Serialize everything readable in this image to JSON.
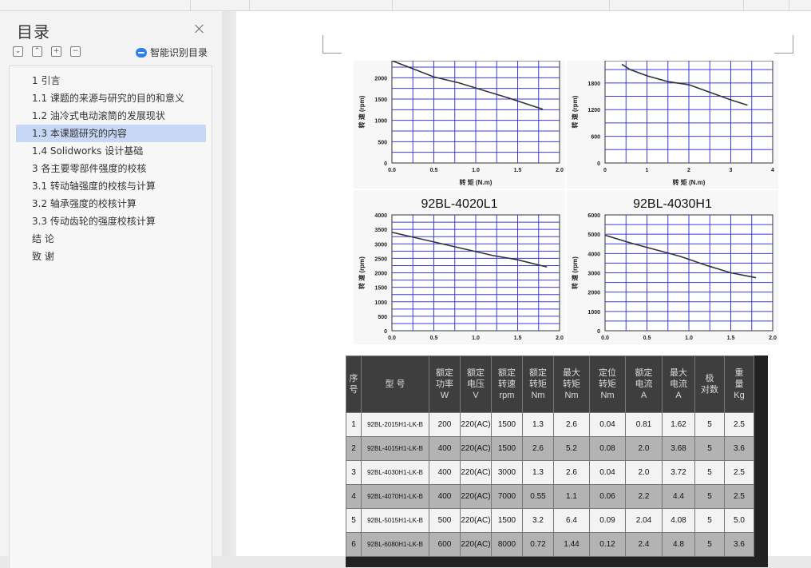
{
  "toc": {
    "title": "目录",
    "smart_label": "智能识别目录",
    "expand_btn": "⌄",
    "collapse_btn": "⌃",
    "add_btn": "+",
    "remove_btn": "−",
    "items": [
      {
        "label": "1 引言",
        "indent": 0,
        "active": false
      },
      {
        "label": "1.1  课题的来源与研究的目的和意义",
        "indent": 0,
        "active": false
      },
      {
        "label": "1.2  油冷式电动滚筒的发展现状",
        "indent": 0,
        "active": false
      },
      {
        "label": "1.3  本课题研究的内容",
        "indent": 0,
        "active": true
      },
      {
        "label": "1.4 Solidworks 设计基础",
        "indent": 0,
        "active": false
      },
      {
        "label": "3 各主要零部件强度的校核",
        "indent": 0,
        "active": false
      },
      {
        "label": "3.1  转动轴强度的校核与计算",
        "indent": 0,
        "active": false
      },
      {
        "label": "3.2  轴承强度的校核计算",
        "indent": 0,
        "active": false
      },
      {
        "label": "3.3  传动齿轮的强度校核计算",
        "indent": 0,
        "active": false
      },
      {
        "label": "结      论",
        "indent": 0,
        "active": false
      },
      {
        "label": "致      谢",
        "indent": 0,
        "active": false
      }
    ]
  },
  "chart_data": [
    {
      "type": "line",
      "title": "",
      "xlabel": "转  矩   (N.m)",
      "ylabel": "转 速  (rpm)",
      "xlim": [
        0,
        2.0
      ],
      "x_ticks": [
        "0.0",
        "0.5",
        "1.0",
        "1.5",
        "2.0"
      ],
      "y_ticks": [
        "0",
        "500",
        "1000",
        "1500",
        "2000"
      ],
      "series": [
        {
          "x": [
            0.0,
            0.2,
            0.5,
            0.8,
            1.1,
            1.4,
            1.8
          ],
          "y": [
            2400,
            2250,
            2020,
            1880,
            1700,
            1520,
            1260
          ]
        }
      ]
    },
    {
      "type": "line",
      "title": "",
      "xlabel": "转  矩   (N.m)",
      "ylabel": "转 速  (rpm)",
      "xlim": [
        0,
        4
      ],
      "x_ticks": [
        "0",
        "1",
        "2",
        "3",
        "4"
      ],
      "y_ticks": [
        "0",
        "600",
        "1200",
        "1800"
      ],
      "series": [
        {
          "x": [
            0.4,
            0.6,
            1.0,
            1.5,
            2.0,
            2.5,
            3.0,
            3.4
          ],
          "y": [
            2220,
            2100,
            1960,
            1830,
            1760,
            1590,
            1420,
            1300
          ]
        }
      ]
    },
    {
      "type": "line",
      "title": "92BL-4020L1",
      "xlabel": "",
      "ylabel": "转 速  (rpm)",
      "xlim": [
        0,
        2.0
      ],
      "ylim": [
        0,
        4000
      ],
      "x_ticks": [
        "0.0",
        "0.5",
        "1.0",
        "1.5",
        "2.0"
      ],
      "y_ticks": [
        "0",
        "500",
        "1000",
        "1500",
        "2000",
        "2500",
        "3000",
        "3500",
        "4000"
      ],
      "series": [
        {
          "x": [
            0.0,
            0.3,
            0.6,
            0.9,
            1.2,
            1.5,
            1.85
          ],
          "y": [
            3400,
            3200,
            3000,
            2800,
            2600,
            2450,
            2200
          ]
        }
      ]
    },
    {
      "type": "line",
      "title": "92BL-4030H1",
      "xlabel": "",
      "ylabel": "转 速  (rpm)",
      "xlim": [
        0,
        2.0
      ],
      "ylim": [
        0,
        6000
      ],
      "x_ticks": [
        "0.0",
        "0.5",
        "1.0",
        "1.5",
        "2.0"
      ],
      "y_ticks": [
        "0",
        "1000",
        "2000",
        "3000",
        "4000",
        "5000",
        "6000"
      ],
      "series": [
        {
          "x": [
            0.0,
            0.3,
            0.6,
            0.9,
            1.2,
            1.5,
            1.8
          ],
          "y": [
            4950,
            4550,
            4200,
            3850,
            3400,
            3000,
            2750
          ]
        }
      ]
    },
    {
      "type": "table",
      "headers": [
        [
          "序",
          "号"
        ],
        [
          "型      号"
        ],
        [
          "额定",
          "功率",
          "W"
        ],
        [
          "额定",
          "电压",
          "V"
        ],
        [
          "额定",
          "转速",
          "rpm"
        ],
        [
          "额定",
          "转矩",
          "Nm"
        ],
        [
          "最大",
          "转矩",
          "Nm"
        ],
        [
          "定位",
          "转矩",
          "Nm"
        ],
        [
          "额定",
          "电流",
          "A"
        ],
        [
          "最大",
          "电流",
          "A"
        ],
        [
          "极",
          "对数"
        ],
        [
          "重",
          "量",
          "Kg"
        ]
      ],
      "rows": [
        [
          "1",
          "92BL-2015H1-LK-B",
          "200",
          "220(AC)",
          "1500",
          "1.3",
          "2.6",
          "0.04",
          "0.81",
          "1.62",
          "5",
          "2.5"
        ],
        [
          "2",
          "92BL-4015H1-LK-B",
          "400",
          "220(AC)",
          "1500",
          "2.6",
          "5.2",
          "0.08",
          "2.0",
          "3.68",
          "5",
          "3.6"
        ],
        [
          "3",
          "92BL-4030H1-LK-B",
          "400",
          "220(AC)",
          "3000",
          "1.3",
          "2.6",
          "0.04",
          "2.0",
          "3.72",
          "5",
          "2.5"
        ],
        [
          "4",
          "92BL-4070H1-LK-B",
          "400",
          "220(AC)",
          "7000",
          "0.55",
          "1.1",
          "0.06",
          "2.2",
          "4.4",
          "5",
          "2.5"
        ],
        [
          "5",
          "92BL-5015H1-LK-B",
          "500",
          "220(AC)",
          "1500",
          "3.2",
          "6.4",
          "0.09",
          "2.04",
          "4.08",
          "5",
          "5.0"
        ],
        [
          "6",
          "92BL-6080H1-LK-B",
          "600",
          "220(AC)",
          "8000",
          "0.72",
          "1.44",
          "0.12",
          "2.4",
          "4.8",
          "5",
          "3.6"
        ]
      ]
    }
  ]
}
